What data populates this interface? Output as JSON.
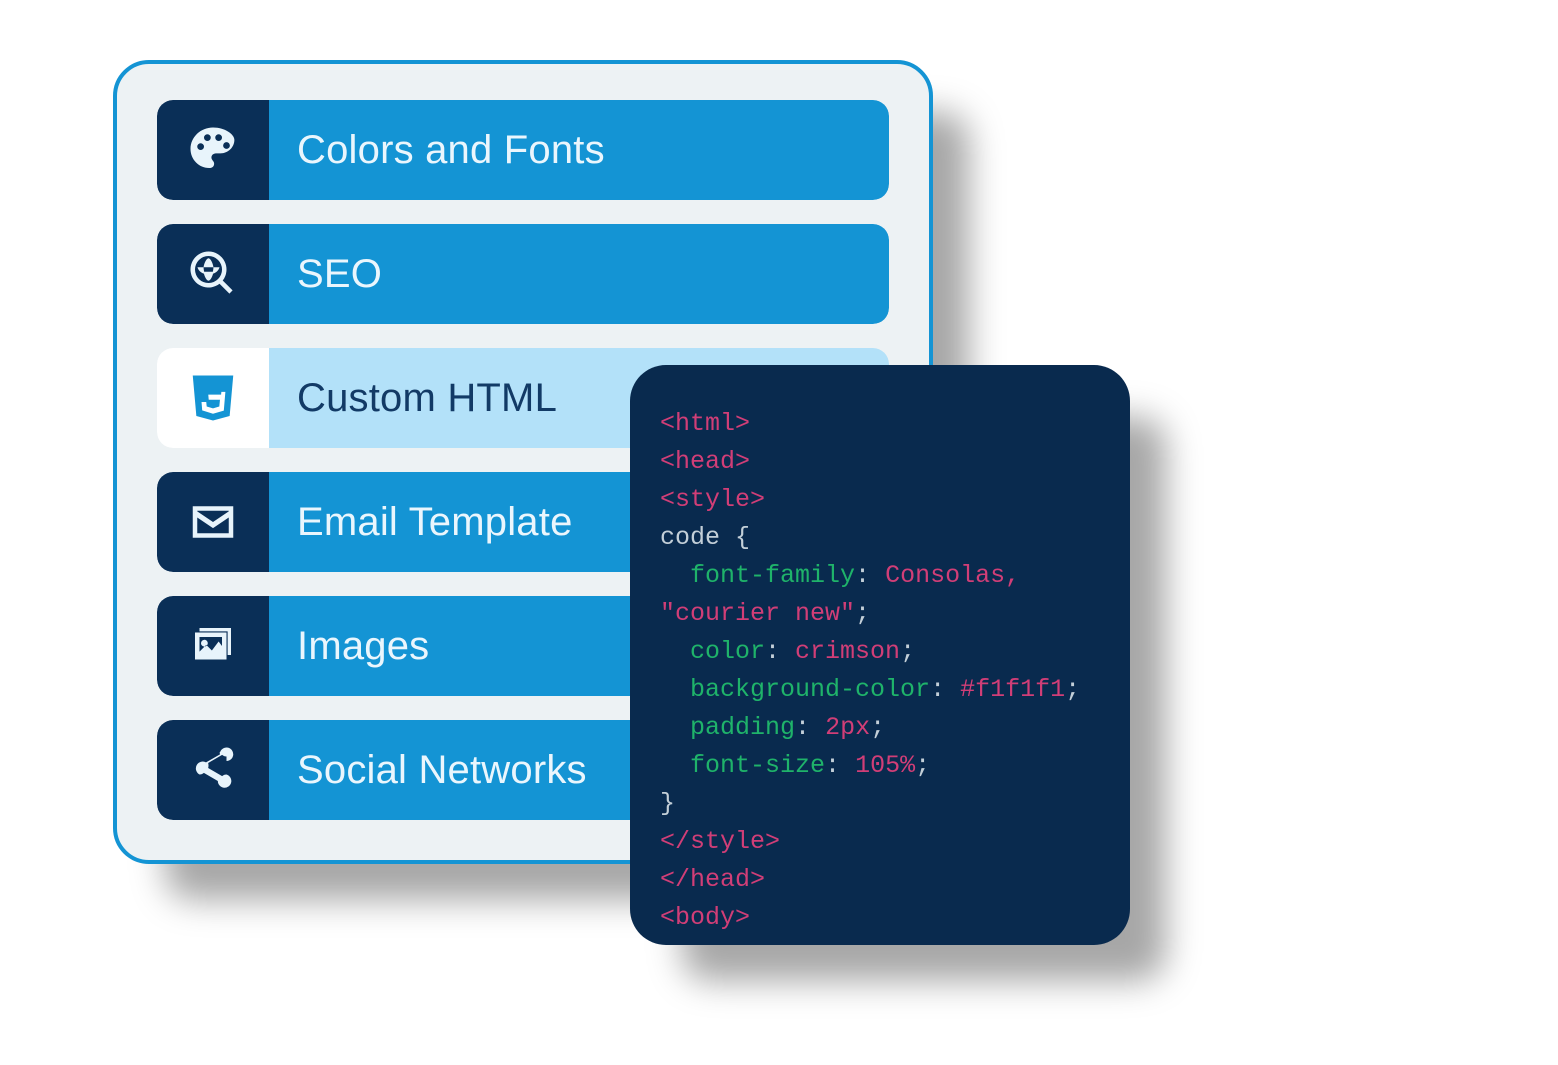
{
  "menu": {
    "items": [
      {
        "id": "colors-fonts",
        "label": "Colors and Fonts",
        "icon": "palette-icon",
        "selected": false
      },
      {
        "id": "seo",
        "label": "SEO",
        "icon": "globe-search-icon",
        "selected": false
      },
      {
        "id": "custom-html",
        "label": "Custom HTML",
        "icon": "html5-icon",
        "selected": true
      },
      {
        "id": "email-template",
        "label": "Email Template",
        "icon": "envelope-icon",
        "selected": false
      },
      {
        "id": "images",
        "label": "Images",
        "icon": "images-icon",
        "selected": false
      },
      {
        "id": "social",
        "label": "Social Networks",
        "icon": "share-icon",
        "selected": false
      }
    ]
  },
  "code": {
    "tokens": [
      {
        "t": "tag",
        "v": "<html>"
      },
      {
        "t": "nl"
      },
      {
        "t": "tag",
        "v": "<head>"
      },
      {
        "t": "nl"
      },
      {
        "t": "tag",
        "v": "<style>"
      },
      {
        "t": "nl"
      },
      {
        "t": "punc",
        "v": "code {"
      },
      {
        "t": "nl"
      },
      {
        "t": "punc",
        "v": "  "
      },
      {
        "t": "prop",
        "v": "font-family"
      },
      {
        "t": "punc",
        "v": ": "
      },
      {
        "t": "val",
        "v": "Consolas,"
      },
      {
        "t": "nl"
      },
      {
        "t": "val",
        "v": "\"courier new\""
      },
      {
        "t": "punc",
        "v": ";"
      },
      {
        "t": "nl"
      },
      {
        "t": "punc",
        "v": "  "
      },
      {
        "t": "prop",
        "v": "color"
      },
      {
        "t": "punc",
        "v": ": "
      },
      {
        "t": "val",
        "v": "crimson"
      },
      {
        "t": "punc",
        "v": ";"
      },
      {
        "t": "nl"
      },
      {
        "t": "punc",
        "v": "  "
      },
      {
        "t": "prop",
        "v": "background-color"
      },
      {
        "t": "punc",
        "v": ": "
      },
      {
        "t": "val",
        "v": "#f1f1f1"
      },
      {
        "t": "punc",
        "v": ";"
      },
      {
        "t": "nl"
      },
      {
        "t": "punc",
        "v": "  "
      },
      {
        "t": "prop",
        "v": "padding"
      },
      {
        "t": "punc",
        "v": ": "
      },
      {
        "t": "val",
        "v": "2px"
      },
      {
        "t": "punc",
        "v": ";"
      },
      {
        "t": "nl"
      },
      {
        "t": "punc",
        "v": "  "
      },
      {
        "t": "prop",
        "v": "font-size"
      },
      {
        "t": "punc",
        "v": ": "
      },
      {
        "t": "val",
        "v": "105%"
      },
      {
        "t": "punc",
        "v": ";"
      },
      {
        "t": "nl"
      },
      {
        "t": "punc",
        "v": "}"
      },
      {
        "t": "nl"
      },
      {
        "t": "tag",
        "v": "</style>"
      },
      {
        "t": "nl"
      },
      {
        "t": "tag",
        "v": "</head>"
      },
      {
        "t": "nl"
      },
      {
        "t": "tag",
        "v": "<body>"
      }
    ]
  },
  "icons": {
    "palette-icon": "palette",
    "globe-search-icon": "globe-search",
    "html5-icon": "html5",
    "envelope-icon": "envelope",
    "images-icon": "images",
    "share-icon": "share"
  }
}
